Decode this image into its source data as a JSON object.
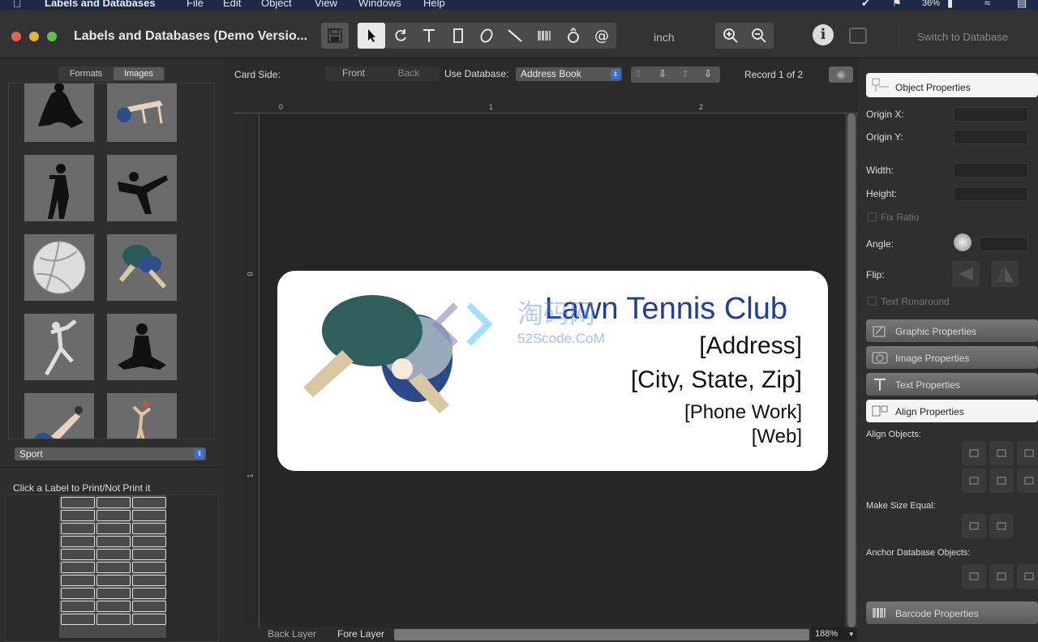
{
  "menubar": {
    "app_name": "Labels and Databases",
    "items": [
      "File",
      "Edit",
      "Object",
      "View",
      "Windows",
      "Help"
    ],
    "battery": "36%"
  },
  "toolbar": {
    "window_title": "Labels and Databases (Demo Versio...",
    "unit": "inch",
    "switch_label": "Switch to Database"
  },
  "left": {
    "tabs": {
      "formats": "Formats",
      "images": "Images"
    },
    "category": "Sport",
    "print_hint": "Click a Label to Print/Not Print it"
  },
  "editbar": {
    "card_side_label": "Card Side:",
    "front": "Front",
    "back": "Back",
    "use_db_label": "Use Database:",
    "db_value": "Address Book",
    "record": "Record 1 of 2"
  },
  "ruler": {
    "h": [
      "0",
      "1",
      "2"
    ],
    "v": [
      "0",
      "1"
    ]
  },
  "card": {
    "title": "Lawn Tennis Club",
    "line1": "[Address]",
    "line2": "[City, State, Zip]",
    "line3": "[Phone Work]",
    "line4": "[Web]",
    "watermark_main": "淘码网",
    "watermark_sub": "52Scode.CoM"
  },
  "bottom": {
    "back_layer": "Back Layer",
    "fore_layer": "Fore Layer",
    "zoom": "188%"
  },
  "right": {
    "object_properties": "Object Properties",
    "origin_x": "Origin X:",
    "origin_y": "Origin Y:",
    "width": "Width:",
    "height": "Height:",
    "fix_ratio": "Fix Ratio",
    "angle": "Angle:",
    "flip": "Flip:",
    "text_runaround": "Text Runaround",
    "graphic_properties": "Graphic Properties",
    "image_properties": "Image Properties",
    "text_properties": "Text Properties",
    "align_properties": "Align Properties",
    "align_objects": "Align Objects:",
    "make_size_equal": "Make Size Equal:",
    "anchor_db": "Anchor Database Objects:",
    "barcode_properties": "Barcode Properties"
  },
  "colors": {
    "title_blue": "#1f3e9a",
    "card_bg": "#ffffff",
    "canvas_bg": "#262626"
  }
}
